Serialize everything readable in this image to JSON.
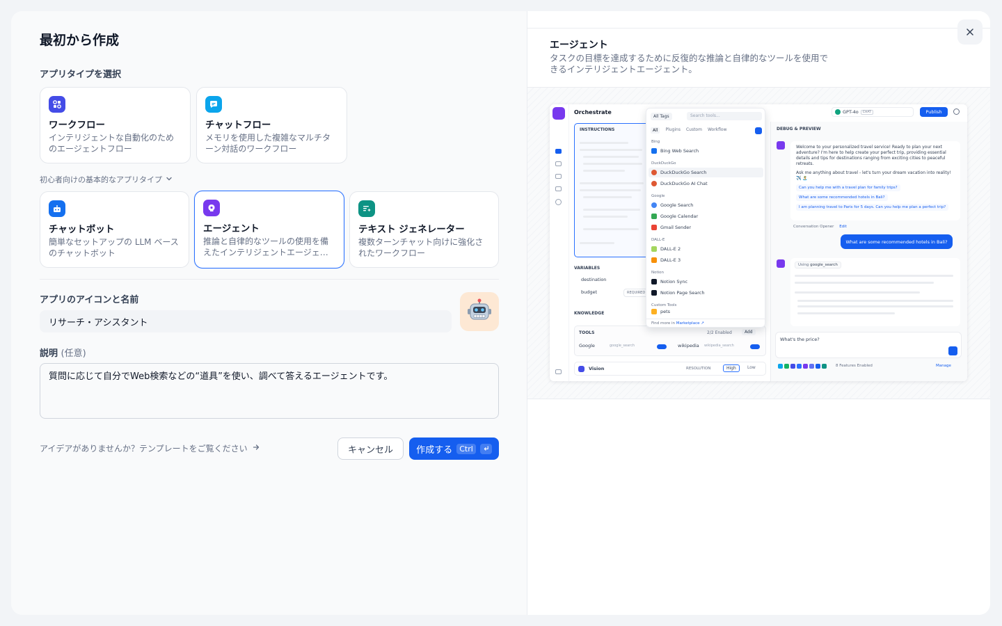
{
  "modal": {
    "title": "最初から作成",
    "close_icon": "close-icon"
  },
  "app_type": {
    "label": "アプリタイプを選択",
    "advanced_cards": [
      {
        "title": "ワークフロー",
        "desc": "インテリジェントな自動化のためのエージェントフロー",
        "icon": "workflow-icon",
        "color": "#444ce7"
      },
      {
        "title": "チャットフロー",
        "desc": "メモリを使用した複雑なマルチターン対話のワークフロー",
        "icon": "chatflow-icon",
        "color": "#0ba5ec"
      }
    ],
    "basic_toggle_label": "初心者向けの基本的なアプリタイプ",
    "basic_cards": [
      {
        "title": "チャットボット",
        "desc": "簡単なセットアップの LLM ベースのチャットボット",
        "icon": "chatbot-icon",
        "color": "#1570ef"
      },
      {
        "title": "エージェント",
        "desc": "推論と自律的なツールの使用を備えたインテリジェントエージェント",
        "icon": "agent-icon",
        "color": "#7839ee"
      },
      {
        "title": "テキスト ジェネレーター",
        "desc": "複数ターンチャット向けに強化されたワークフロー",
        "icon": "text-generator-icon",
        "color": "#0e9384"
      }
    ],
    "selected": "エージェント"
  },
  "app_name": {
    "label": "アプリのアイコンと名前",
    "value": "リサーチ・アシスタント",
    "avatar_icon": "robot-emoji-icon"
  },
  "description": {
    "label": "説明",
    "optional": "(任意)",
    "value": "質問に応じて自分でWeb検索などの“道具”を使い、調べて答えるエージェントです。"
  },
  "footer": {
    "template_link": "アイデアがありませんか？テンプレートをご覧ください",
    "cancel_label": "キャンセル",
    "create_label": "作成する",
    "shortcut": "Ctrl"
  },
  "preview": {
    "title": "エージェント",
    "desc": "タスクの目標を達成するために反復的な推論と自律的なツールを使用できるインテリジェントエージェント。",
    "screenshot": {
      "orchestrate": "Orchestrate",
      "instructions": "INSTRUCTIONS",
      "variables": "VARIABLES",
      "var1": "destination",
      "var2": "budget",
      "required": "REQUIRED",
      "knowledge": "KNOWLEDGE",
      "tools": "TOOLS",
      "tools_enabled": "2/2 Enabled",
      "add": "Add",
      "tool1": "Google",
      "tool1_id": "google_search",
      "tool2": "wikipedia",
      "tool2_id": "wikipedia_search",
      "vision": "Vision",
      "resolution": "RESOLUTION",
      "high": "High",
      "low": "Low",
      "all_tags": "All Tags",
      "search_tools": "Search tools...",
      "tabs": [
        "All",
        "Plugins",
        "Custom",
        "Workflow"
      ],
      "groups": [
        {
          "name": "Bing",
          "items": [
            "Bing Web Search"
          ]
        },
        {
          "name": "DuckDuckGo",
          "items": [
            "DuckDuckGo Search",
            "DuckDuckGo AI Chat"
          ]
        },
        {
          "name": "Google",
          "items": [
            "Google Search",
            "Google Calendar",
            "Gmail Sender"
          ]
        },
        {
          "name": "DALL-E",
          "items": [
            "DALL-E 2",
            "DALL-E 3"
          ]
        },
        {
          "name": "Notion",
          "items": [
            "Notion Sync",
            "Notion Page Search"
          ]
        },
        {
          "name": "Custom Tools",
          "items": [
            "pets"
          ]
        }
      ],
      "find_more": "Find more in",
      "marketplace": "Marketplace ↗",
      "model": "GPT-4o",
      "chat_tag": "CHAT",
      "publish": "Publish",
      "debug": "DEBUG & PREVIEW",
      "welcome": "Welcome to your personalized travel service! Ready to plan your next adventure? I'm here to help create your perfect trip, providing essential details and tips for destinations ranging from exciting cities to peaceful retreats.",
      "ask": "Ask me anything about travel - let's turn your dream vacation into reality! ✈️ 🏝️",
      "suggestions": [
        "Can you help me with a travel plan for family trips?",
        "What are some recommended hotels in Bali?",
        "I am planning travel to Paris for 5 days. Can you help me plan a perfect trip?"
      ],
      "opener": "Conversation Opener",
      "edit": "Edit",
      "user_msg": "What are some recommended hotels in Bali?",
      "using": "Using",
      "using_tool": "google_search",
      "input_text": "What's the price?",
      "features": "8 Features Enabled",
      "manage": "Manage"
    }
  }
}
